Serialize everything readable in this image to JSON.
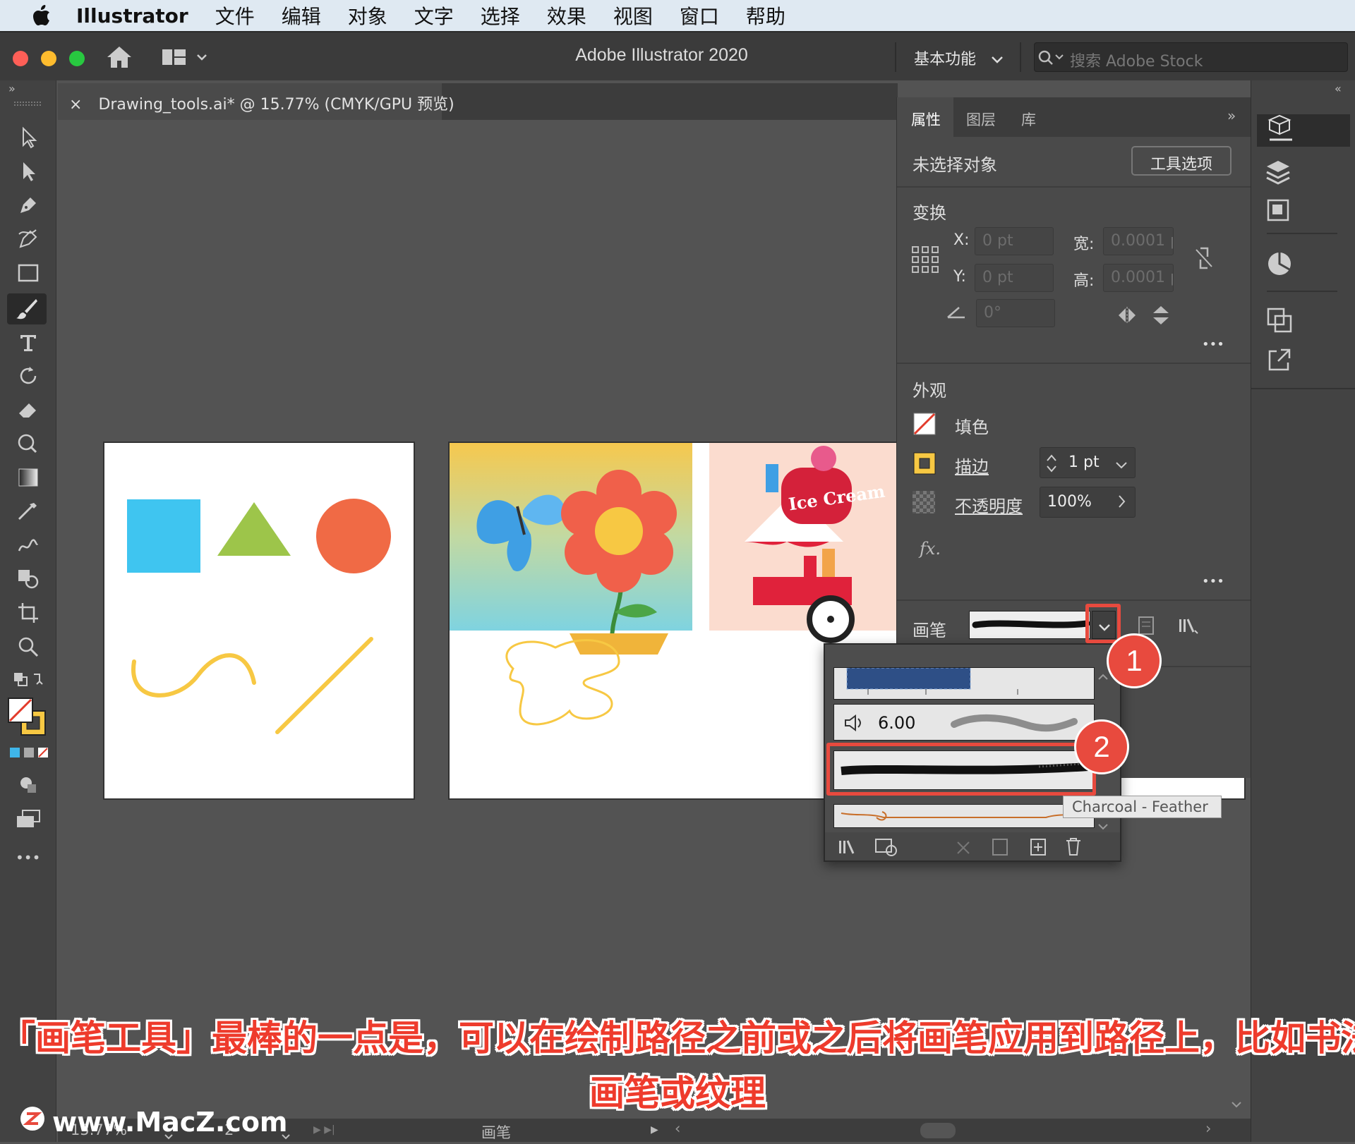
{
  "menubar": {
    "app_name": "Illustrator",
    "items": [
      "文件",
      "编辑",
      "对象",
      "文字",
      "选择",
      "效果",
      "视图",
      "窗口",
      "帮助"
    ]
  },
  "appbar": {
    "title": "Adobe Illustrator 2020",
    "workspace": "基本功能",
    "stock_placeholder": "搜索 Adobe Stock"
  },
  "document": {
    "tab_title": "Drawing_tools.ai* @ 15.77% (CMYK/GPU 预览)",
    "close": "×",
    "artwork": {
      "ice_cream_sign": "Ice Cream"
    }
  },
  "properties": {
    "tabs": [
      "属性",
      "图层",
      "库"
    ],
    "no_selection": "未选择对象",
    "tool_options": "工具选项",
    "transform_title": "变换",
    "x_label": "X:",
    "y_label": "Y:",
    "w_label": "宽:",
    "h_label": "高:",
    "x_value": "0 pt",
    "y_value": "0 pt",
    "w_value": "0.0001 p",
    "h_value": "0.0001 p",
    "angle_value": "0°",
    "appearance_title": "外观",
    "fill_label": "填色",
    "stroke_label": "描边",
    "stroke_value": "1 pt",
    "opacity_label": "不透明度",
    "opacity_value": "100%",
    "fx_label": "fx.",
    "brush_label": "画笔",
    "more": "•••"
  },
  "brush_popup": {
    "size_value": "6.00",
    "tooltip": "Charcoal - Feather"
  },
  "status": {
    "zoom": "15.77%",
    "page": "2",
    "tool": "画笔"
  },
  "annotations": {
    "badge1": "1",
    "badge2": "2",
    "caption_line1": "「画笔工具」最棒的一点是，可以在绘制路径之前或之后将画笔应用到路径上，比如书法",
    "caption_line2": "画笔或纹理",
    "watermark": "www.MacZ.com"
  },
  "colors": {
    "accent_red": "#e84a3e",
    "square_blue": "#3fc5f0",
    "triangle_green": "#9dc54a",
    "circle_orange": "#f06a45",
    "stroke_yellow": "#f7c843"
  }
}
